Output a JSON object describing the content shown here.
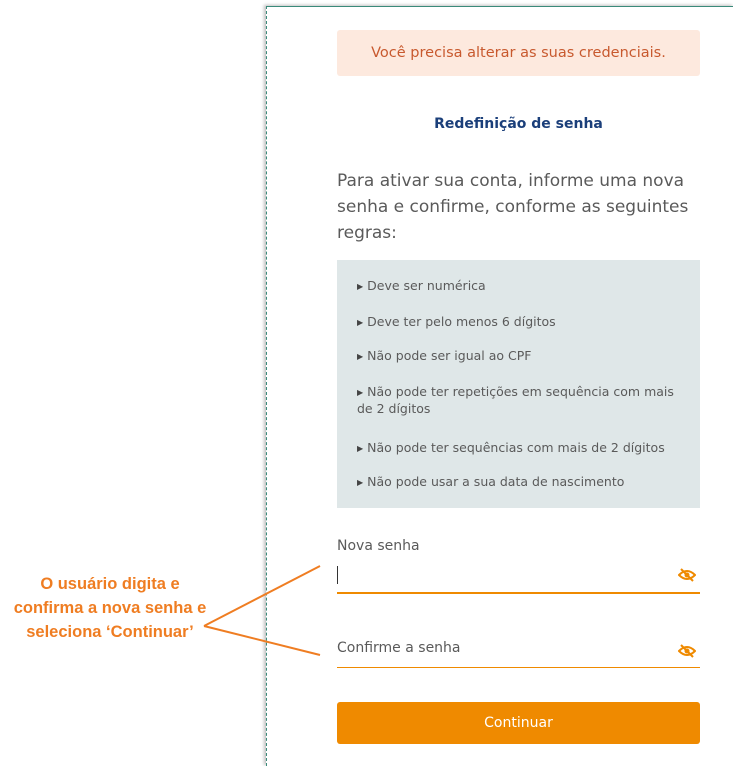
{
  "alert": {
    "text": "Você precisa alterar as suas credenciais."
  },
  "form": {
    "title": "Redefinição de senha",
    "intro": "Para ativar sua conta, informe uma nova senha e confirme, conforme as seguintes regras:",
    "rules": [
      "Deve ser numérica",
      "Deve ter pelo menos 6 dígitos",
      "Não pode ser igual ao CPF",
      "Não pode ter repetições em sequência com mais de 2 dígitos",
      "Não pode ter sequências com mais de 2 dígitos",
      "Não pode usar a sua data de nascimento"
    ],
    "new_password": {
      "label": "Nova senha",
      "value": ""
    },
    "confirm_password": {
      "label": "Confirme a senha",
      "value": ""
    },
    "submit_label": "Continuar"
  },
  "annotation": {
    "text": "O usuário digita e confirma a nova senha e seleciona ‘Continuar’"
  },
  "colors": {
    "accent": "#ef8a00",
    "title": "#1b3f7a",
    "alert_bg": "#fde9de",
    "rules_bg": "#dfe7e8"
  },
  "icons": {
    "password_toggle": "eye-slash-icon"
  }
}
